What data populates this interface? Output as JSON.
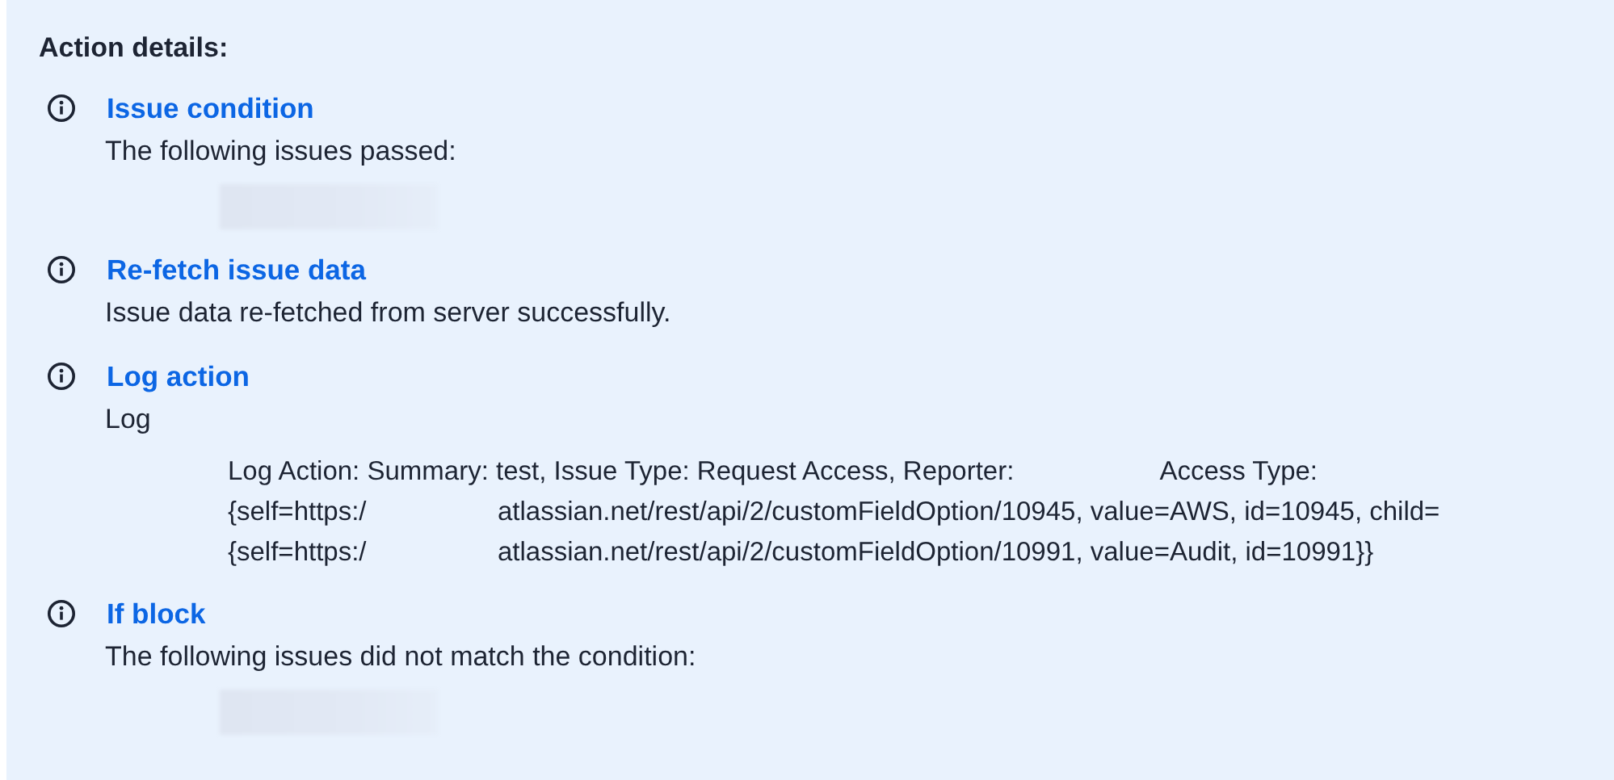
{
  "heading": "Action details:",
  "actions": [
    {
      "title": "Issue condition",
      "message": "The following issues passed:",
      "redacted": true
    },
    {
      "title": "Re-fetch issue data",
      "message": "Issue data re-fetched from server successfully.",
      "redacted": false
    },
    {
      "title": "Log action",
      "message": "Log",
      "redacted": false,
      "log_lines": [
        {
          "kind": "summary",
          "parts": [
            "Log Action: Summary: test, Issue Type: Request Access, Reporter:",
            "Access Type:"
          ]
        },
        {
          "kind": "url",
          "parts": [
            "{self=https:/",
            "atlassian.net/rest/api/2/customFieldOption/10945, value=AWS, id=10945, child="
          ]
        },
        {
          "kind": "url",
          "parts": [
            "{self=https:/",
            "atlassian.net/rest/api/2/customFieldOption/10991, value=Audit, id=10991}}"
          ]
        }
      ]
    },
    {
      "title": "If block",
      "message": "The following issues did not match the condition:",
      "redacted": true
    }
  ]
}
